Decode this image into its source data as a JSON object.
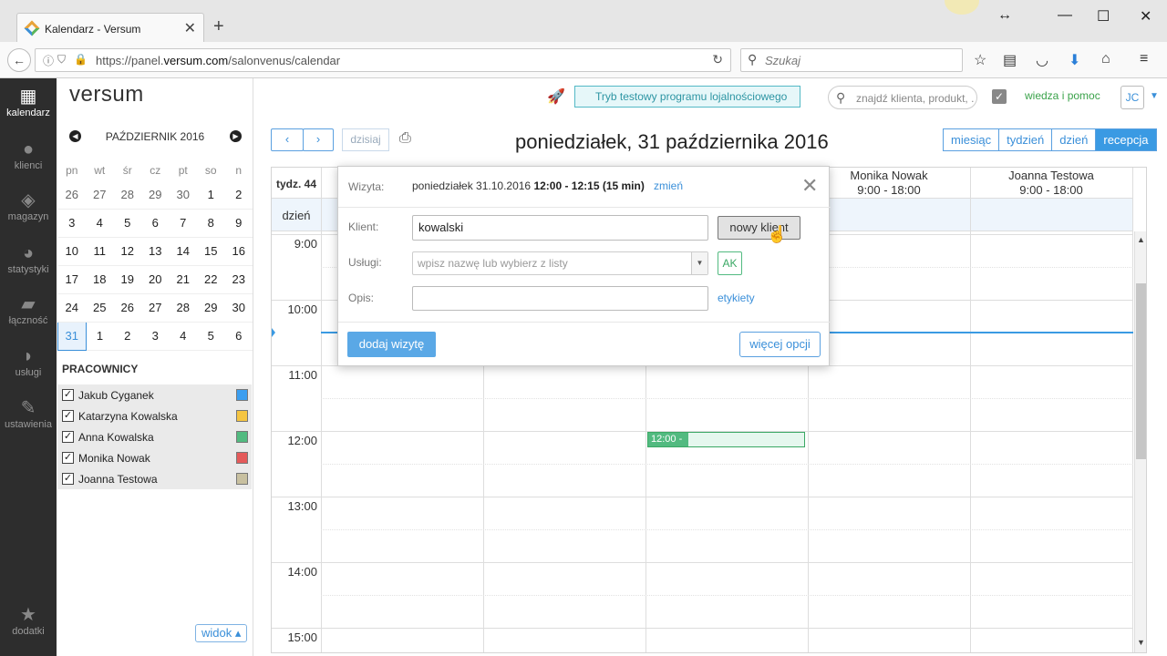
{
  "browser": {
    "tab_title": "Kalendarz - Versum",
    "url_prefix": "https://panel.",
    "url_domain": "versum.com",
    "url_path": "/salonvenus/calendar",
    "search_placeholder": "Szukaj"
  },
  "nav": {
    "items": [
      {
        "label": "kalendarz",
        "icon": "calendar-icon"
      },
      {
        "label": "klienci",
        "icon": "users-icon"
      },
      {
        "label": "magazyn",
        "icon": "dropbox-icon"
      },
      {
        "label": "statystyki",
        "icon": "pie-chart-icon"
      },
      {
        "label": "łączność",
        "icon": "chat-icon"
      },
      {
        "label": "usługi",
        "icon": "hairdryer-icon"
      },
      {
        "label": "ustawienia",
        "icon": "wrench-icon"
      },
      {
        "label": "dodatki",
        "icon": "star-icon"
      }
    ]
  },
  "app": {
    "logo": "versum",
    "loyalty": "Tryb testowy programu lojalnościowego",
    "search_placeholder": "znajdź klienta, produkt, ...",
    "help": "wiedza i pomoc",
    "user_initials": "JC"
  },
  "minical": {
    "month": "PAŹDZIERNIK 2016",
    "dow": [
      "pn",
      "wt",
      "śr",
      "cz",
      "pt",
      "so",
      "n"
    ],
    "weeks": [
      [
        "26",
        "27",
        "28",
        "29",
        "30",
        "1",
        "2"
      ],
      [
        "3",
        "4",
        "5",
        "6",
        "7",
        "8",
        "9"
      ],
      [
        "10",
        "11",
        "12",
        "13",
        "14",
        "15",
        "16"
      ],
      [
        "17",
        "18",
        "19",
        "20",
        "21",
        "22",
        "23"
      ],
      [
        "24",
        "25",
        "26",
        "27",
        "28",
        "29",
        "30"
      ],
      [
        "31",
        "1",
        "2",
        "3",
        "4",
        "5",
        "6"
      ]
    ]
  },
  "staff": {
    "title": "PRACOWNICY",
    "people": [
      {
        "name": "Jakub Cyganek",
        "color": "#3b9ef0"
      },
      {
        "name": "Katarzyna Kowalska",
        "color": "#f5c542"
      },
      {
        "name": "Anna Kowalska",
        "color": "#52ba80"
      },
      {
        "name": "Monika Nowak",
        "color": "#e45a5a"
      },
      {
        "name": "Joanna Testowa",
        "color": "#c8c0a0"
      }
    ]
  },
  "widok": "widok ▴",
  "toolbar": {
    "today": "dzisiaj",
    "date_title": "poniedziałek, 31 października 2016",
    "views": [
      "miesiąc",
      "tydzień",
      "dzień",
      "recepcja"
    ]
  },
  "grid": {
    "week": "tydz. 44",
    "day": "dzień",
    "columns": [
      {
        "name": "Monika Nowak",
        "hours": "9:00 - 18:00"
      },
      {
        "name": "Joanna Testowa",
        "hours": "9:00 - 18:00"
      }
    ],
    "hours": [
      "9:00",
      "10:00",
      "11:00",
      "12:00",
      "13:00",
      "14:00",
      "15:00"
    ],
    "appointment": "12:00 -"
  },
  "modal": {
    "visit_label": "Wizyta:",
    "visit_date": "poniedziałek 31.10.2016",
    "visit_time": "12:00 - 12:15 (15 min)",
    "change": "zmień",
    "client_label": "Klient:",
    "client_value": "kowalski",
    "new_client": "nowy klient",
    "services_label": "Usługi:",
    "services_placeholder": "wpisz nazwę lub wybierz z listy",
    "ak": "AK",
    "desc_label": "Opis:",
    "tags": "etykiety",
    "add": "dodaj wizytę",
    "more": "więcej opcji"
  }
}
